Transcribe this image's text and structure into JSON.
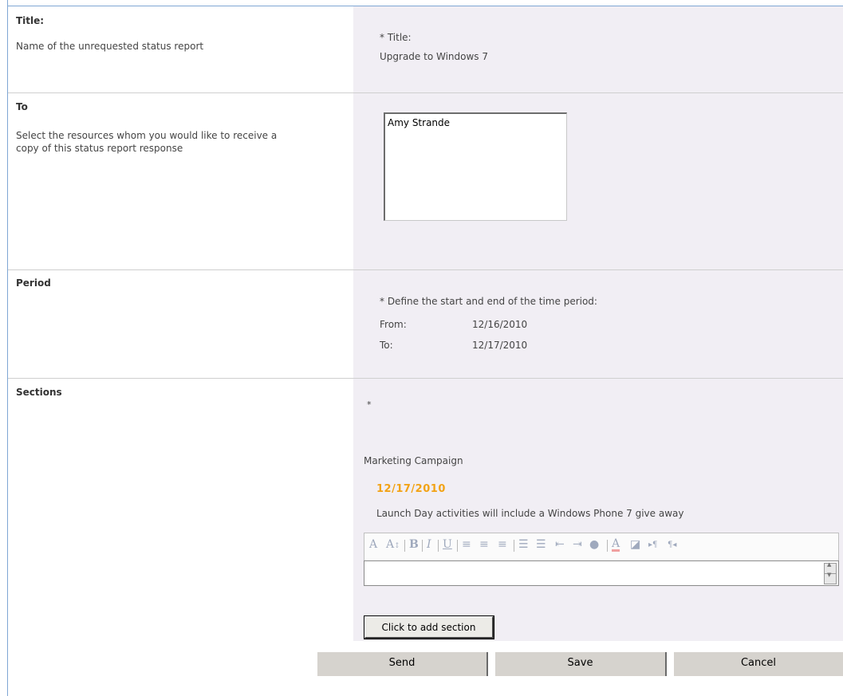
{
  "title_section": {
    "heading": "Title:",
    "description": "Name of the unrequested status report",
    "field_label": "* Title:",
    "value": "Upgrade to Windows 7"
  },
  "to_section": {
    "heading": "To",
    "description_line1": "Select the resources whom you would like to receive a",
    "description_line2": "copy of this status report response",
    "recipients": [
      "Amy Strande"
    ]
  },
  "period_section": {
    "heading": "Period",
    "instruction": "* Define the start and end of the time period:",
    "from_label": "From:",
    "from_value": "12/16/2010",
    "to_label": "To:",
    "to_value": "12/17/2010"
  },
  "sections_section": {
    "heading": "Sections",
    "required_marker": "*",
    "section_name": "Marketing Campaign",
    "entry_date": "12/17/2010",
    "entry_text": "Launch Day activities will include a Windows Phone 7 give away",
    "editor_value": "",
    "toolbar_icons": [
      "font-icon",
      "font-size-icon",
      "bold-icon",
      "italic-icon",
      "underline-icon",
      "align-left-icon",
      "align-center-icon",
      "align-right-icon",
      "numbered-list-icon",
      "bulleted-list-icon",
      "decrease-indent-icon",
      "increase-indent-icon",
      "hyperlink-icon",
      "text-color-icon",
      "highlight-icon",
      "ltr-icon",
      "rtl-icon"
    ],
    "add_button": "Click to add section"
  },
  "buttons": {
    "send": "Send",
    "save": "Save",
    "cancel": "Cancel"
  },
  "colors": {
    "accent_date": "#f2a316",
    "right_panel_bg": "#f1eef4",
    "frame_border": "#7fa7d4"
  }
}
